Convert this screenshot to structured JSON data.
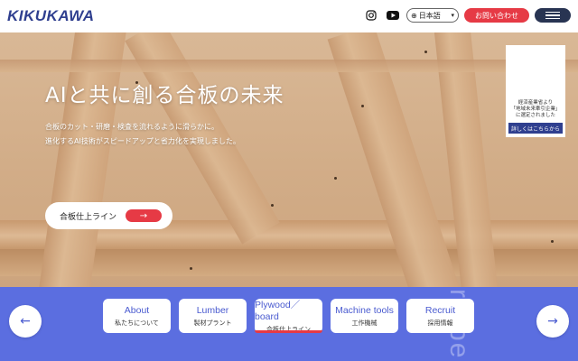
{
  "header": {
    "logo": "KIKUKAWA",
    "instagram_icon": "instagram-icon",
    "youtube_icon": "youtube-icon",
    "language": "日本語",
    "contact_label": "お問い合わせ",
    "menu_icon": "hamburger-menu-icon"
  },
  "hero": {
    "title": "AIと共に創る合板の未来",
    "desc_line1": "合板のカット・研磨・検査を流れるように滑らかに。",
    "desc_line2": "進化するAI技術がスピードアップと省力化を実現しました。",
    "cta_label": "合板仕上ライン",
    "cta_icon": "arrow-right-icon"
  },
  "award": {
    "line1": "経済産業省より",
    "line2": "「地域未来牽引企業」",
    "line3": "に選定されました",
    "link_label": "詳しくはこちらから"
  },
  "band_word": "re pe",
  "nav": {
    "prev_icon": "arrow-left-icon",
    "next_icon": "arrow-right-icon"
  },
  "cards": [
    {
      "en": "About",
      "ja": "私たちについて"
    },
    {
      "en": "Lumber",
      "ja": "製材プラント"
    },
    {
      "en": "Plywood／board",
      "ja": "合板仕上ライン"
    },
    {
      "en": "Machine tools",
      "ja": "工作機械"
    },
    {
      "en": "Recruit",
      "ja": "採用情報"
    }
  ],
  "colors": {
    "brand": "#2f3f8f",
    "accent_red": "#e63a45",
    "band_blue": "#5b6ee0",
    "card_text_blue": "#4a5bd0"
  }
}
